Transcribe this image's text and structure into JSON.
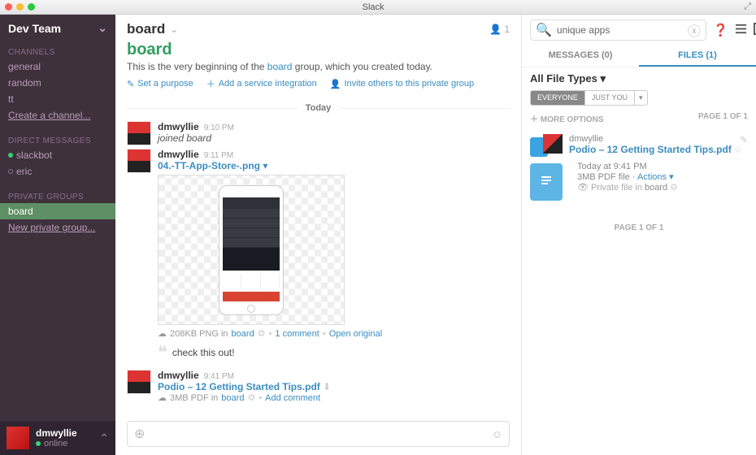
{
  "titlebar": {
    "title": "Slack"
  },
  "sidebar": {
    "team": "Dev Team",
    "channels_label": "CHANNELS",
    "channels": [
      {
        "name": "general"
      },
      {
        "name": "random"
      },
      {
        "name": "tt"
      }
    ],
    "create_channel": "Create a channel...",
    "dm_label": "DIRECT MESSAGES",
    "dms": [
      {
        "name": "slackbot",
        "online": true
      },
      {
        "name": "eric",
        "online": false
      }
    ],
    "groups_label": "PRIVATE GROUPS",
    "groups": [
      {
        "name": "board",
        "selected": true
      }
    ],
    "new_group": "New private group...",
    "me": {
      "name": "dmwyllie",
      "status": "online"
    }
  },
  "channel": {
    "name": "board",
    "member_count": "1",
    "big_name": "board",
    "desc_pre": "This is the very beginning of the ",
    "desc_link": "board",
    "desc_post": " group, which you created today.",
    "set_purpose": "Set a purpose",
    "add_integration": "Add a service integration",
    "invite": "Invite others to this private group",
    "today": "Today"
  },
  "messages": {
    "m1": {
      "user": "dmwyllie",
      "time": "9:10 PM",
      "text": "joined board"
    },
    "m2": {
      "user": "dmwyllie",
      "time": "9:11 PM",
      "file_name": "04.-TT-App-Store-.png",
      "meta_size": "208KB PNG in ",
      "meta_channel": "board",
      "comments": "1 comment",
      "open_original": "Open original",
      "quote": "check this out!"
    },
    "m3": {
      "user": "dmwyllie",
      "time": "9:41 PM",
      "file_name": "Podio – 12 Getting Started Tips.pdf",
      "meta_size": "3MB PDF in ",
      "meta_channel": "board",
      "add_comment": "Add comment"
    }
  },
  "search": {
    "placeholder": "unique apps"
  },
  "right": {
    "tab_messages": "MESSAGES (0)",
    "tab_files": "FILES (1)",
    "all_types": "All File Types",
    "pill_everyone": "EVERYONE",
    "pill_justyou": "JUST YOU",
    "more_options": "MORE OPTIONS",
    "page_top": "PAGE 1 OF 1",
    "file": {
      "user": "dmwyllie",
      "title": "Podio – 12 Getting Started Tips.pdf",
      "time": "Today at 9:41 PM",
      "meta": "3MB PDF file",
      "actions": "Actions",
      "priv_pre": "Private file in ",
      "priv_channel": "board"
    },
    "page_bottom": "PAGE 1 OF 1"
  }
}
